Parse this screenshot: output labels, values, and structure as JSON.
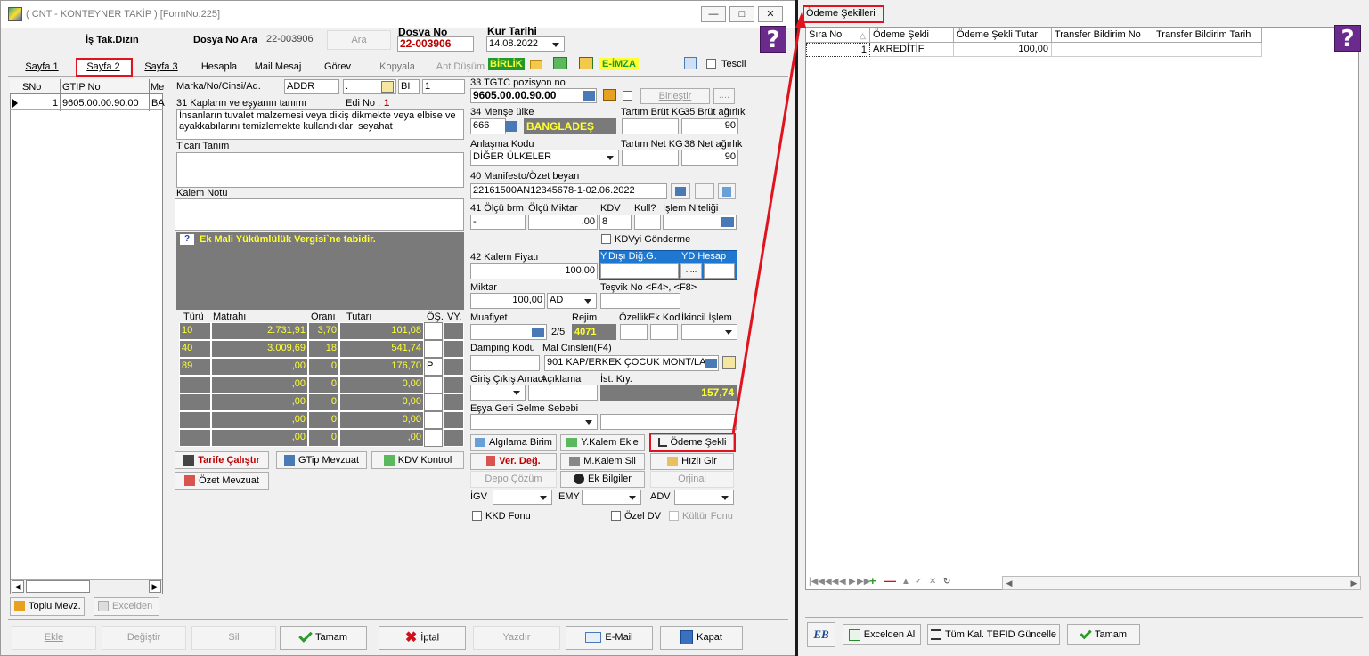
{
  "window": {
    "title": "( CNT - KONTEYNER TAKİP ) [FormNo:225]"
  },
  "header": {
    "is_tak_label": "İş Tak.Dizin",
    "dosya_no_ara_label": "Dosya No Ara",
    "dosya_no_ara_value": "22-003906",
    "ara_button": "Ara",
    "dosya_no_label": "Dosya No",
    "dosya_no_value": "22-003906",
    "kur_tarihi_label": "Kur Tarihi",
    "kur_tarihi_value": "14.08.2022"
  },
  "tabs": [
    {
      "label": "Sayfa 1"
    },
    {
      "label": "Sayfa 2"
    },
    {
      "label": "Sayfa 3"
    },
    {
      "label": "Hesapla"
    },
    {
      "label": "Mail Mesaj"
    },
    {
      "label": "Görev"
    },
    {
      "label": "Kopyala"
    },
    {
      "label": "Ant.Düşüm"
    }
  ],
  "badges": {
    "birlik": "BİRLİK",
    "eimza": "E-İMZA",
    "tescil": "Tescil"
  },
  "left_grid": {
    "headers": [
      "SNo",
      "GTIP No",
      "Me"
    ],
    "row": {
      "sno": "1",
      "gtip": "9605.00.00.90.00",
      "me": "BA"
    }
  },
  "left_buttons": {
    "toplu": "Toplu Mevz.",
    "excelden": "Excelden"
  },
  "form": {
    "marka_label": "Marka/No/Cinsi/Ad.",
    "marka_value": "ADDR",
    "marka_sub": "BI",
    "marka_no": "1",
    "kaplar_label": "31 Kapların ve eşyanın tanımı",
    "edi_label": "Edi No :",
    "edi_value": "1",
    "tanim_text": "İnsanların tuvalet malzemesi veya dikiş dikmekte veya elbise ve ayakkabılarını temizlemekte kullandıkları seyahat",
    "ticari_label": "Ticari Tanım",
    "kalem_notu_label": "Kalem Notu",
    "warning_text": "Ek Mali Yükümlülük Vergisi`ne tabidir.",
    "tax_headers": [
      "Türü",
      "Matrahı",
      "Oranı",
      "Tutarı",
      "ÖŞ.",
      "VY."
    ],
    "tax_rows": [
      {
        "turu": "10",
        "matrah": "2.731,91",
        "oran": "3,70",
        "tutar": "101,08",
        "os": ""
      },
      {
        "turu": "40",
        "matrah": "3.009,69",
        "oran": "18",
        "tutar": "541,74",
        "os": ""
      },
      {
        "turu": "89",
        "matrah": ",00",
        "oran": "0",
        "tutar": "176,70",
        "os": "P"
      },
      {
        "turu": "",
        "matrah": ",00",
        "oran": "0",
        "tutar": "0,00",
        "os": ""
      },
      {
        "turu": "",
        "matrah": ",00",
        "oran": "0",
        "tutar": "0,00",
        "os": ""
      },
      {
        "turu": "",
        "matrah": ",00",
        "oran": "0",
        "tutar": "0,00",
        "os": ""
      },
      {
        "turu": "",
        "matrah": ",00",
        "oran": "0",
        "tutar": ",00",
        "os": ""
      }
    ],
    "btn_tarife": "Tarife Çalıştır",
    "btn_gtip": "GTip Mevzuat",
    "btn_kdv": "KDV Kontrol",
    "btn_ozet": "Özet Mevzuat",
    "tgtc_label": "33 TGTC pozisyon no",
    "tgtc_value": "9605.00.00.90.00",
    "birlestir": "Birleştir",
    "mense_label": "34 Menşe ülke",
    "mense_code": "666",
    "mense_name": "BANGLADEŞ",
    "tartim_brut_label": "Tartım Brüt KG",
    "brut_label": "35 Brüt ağırlık",
    "brut_value": "90",
    "anlasma_label": "Anlaşma Kodu",
    "anlasma_value": "DİĞER ÜLKELER",
    "tartim_net_label": "Tartım Net KG",
    "net_label": "38 Net ağırlık",
    "net_value": "90",
    "manifesto_label": "40 Manifesto/Özet beyan",
    "manifesto_value": "22161500AN12345678-1-02.06.2022",
    "olcu_label": "41 Ölçü brm",
    "olcu_value": "-",
    "olcu_miktar_label": "Ölçü Miktar",
    "olcu_miktar_value": ",00",
    "kdv_label": "KDV",
    "kdv_value": "8",
    "kull_label": "Kull?",
    "islem_label": "İşlem Niteliği",
    "kdvyi_label": "KDVyi Gönderme",
    "kalem_fiyat_label": "42 Kalem Fiyatı",
    "kalem_fiyat_value": "100,00",
    "ydisi_label": "Y.Dışı Diğ.G.",
    "yd_hesap_label": "YD Hesap",
    "miktar_label": "Miktar",
    "miktar_value": "100,00",
    "miktar_unit": "AD",
    "tesvik_label": "Teşvik No <F4>, <F8>",
    "muafiyet_label": "Muafiyet",
    "muafiyet_page": "2/5",
    "rejim_label": "Rejim",
    "rejim_value": "4071",
    "ozellik_label": "Özellik",
    "ek_kod_label": "Ek Kod",
    "ikincil_label": "İkincil İşlem",
    "damping_label": "Damping Kodu",
    "mal_cinsleri_label": "Mal Cinsleri(F4)",
    "mal_cinsleri_value": "901 KAP/ERKEK ÇOCUK MONT/LA",
    "giris_label": "Giriş Çıkış Amacı",
    "aciklama_label": "Açıklama",
    "ist_kiy_label": "İst. Kıy.",
    "ist_kiy_value": "157,74",
    "esya_label": "Eşya Geri Gelme Sebebi",
    "btn_algilama": "Algılama Birim",
    "btn_ykalem": "Y.Kalem Ekle",
    "btn_odeme": "Ödeme Şekli",
    "btn_verdeg": "Ver. Değ.",
    "btn_mkalem": "M.Kalem Sil",
    "btn_hizli": "Hızlı Gir",
    "btn_depo": "Depo Çözüm",
    "btn_ekbilgi": "Ek Bilgiler",
    "btn_orijinal": "Orjinal",
    "igv_label": "İGV",
    "emy_label": "EMY",
    "adv_label": "ADV",
    "kkd_label": "KKD Fonu",
    "ozel_dv_label": "Özel DV",
    "kultur_label": "Kültür Fonu"
  },
  "bottom": {
    "ekle": "Ekle",
    "degistir": "Değiştir",
    "sil": "Sil",
    "tamam": "Tamam",
    "iptal": "İptal",
    "yazdir": "Yazdır",
    "email": "E-Mail",
    "kapat": "Kapat"
  },
  "odeme": {
    "title": "Ödeme Şekilleri",
    "headers": [
      "Sıra No",
      "Ödeme Şekli",
      "Ödeme Şekli Tutar",
      "Transfer Bildirim No",
      "Transfer Bildirim Tarih"
    ],
    "row": {
      "sira": "1",
      "sekli": "AKREDİTİF",
      "tutar": "100,00",
      "tbno": "",
      "tbtarih": ""
    },
    "btn_excel": "Excelden Al",
    "btn_tum": "Tüm Kal. TBFID Güncelle",
    "btn_tamam": "Tamam"
  },
  "colors": {
    "accent": "#e0141e",
    "help_purple": "#6a2b8c",
    "selected_blue": "#1e78d2",
    "yellow_text": "#ffff33"
  }
}
